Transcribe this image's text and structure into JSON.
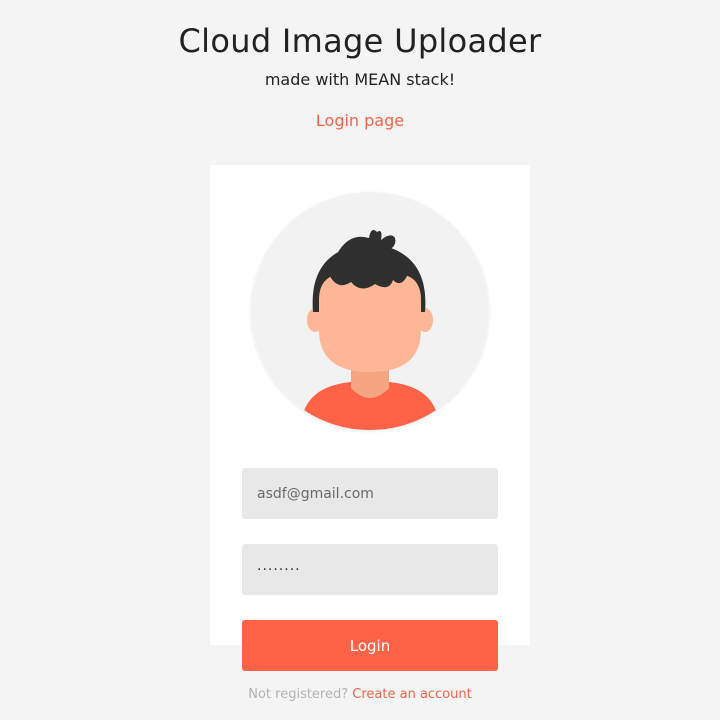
{
  "header": {
    "title": "Cloud Image Uploader",
    "subtitle": "made with MEAN stack!",
    "page_link": "Login page"
  },
  "avatar": {
    "icon": "user-avatar-illustration",
    "colors": {
      "circle_bg": "#f2f2f2",
      "hair": "#2f2f2f",
      "skin": "#fdb797",
      "shirt": "#ff6347"
    }
  },
  "form": {
    "email_value": "asdf@gmail.com",
    "password_value": "········",
    "submit_label": "Login"
  },
  "footer": {
    "prompt": "Not registered?",
    "link_label": "Create an account"
  },
  "colors": {
    "accent": "#ff6347",
    "link": "#f26449",
    "background": "#f4f4f4",
    "card": "#ffffff",
    "input_bg": "#e8e8e8"
  }
}
